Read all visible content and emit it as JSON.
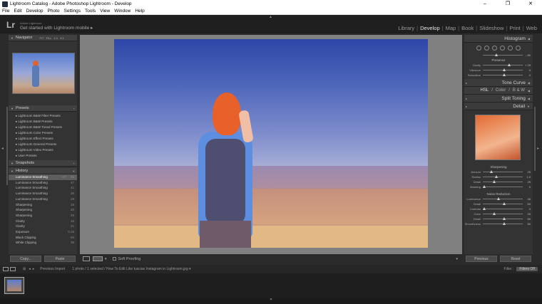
{
  "window": {
    "title": "Lightroom Catalog - Adobe Photoshop Lightroom - Develop",
    "controls": [
      "–",
      "❐",
      "✕"
    ]
  },
  "menu": [
    "File",
    "Edit",
    "Develop",
    "Photo",
    "Settings",
    "Tools",
    "View",
    "Window",
    "Help"
  ],
  "identity": {
    "logo": "Lr",
    "line1": "Adobe Lightroom",
    "line2": "Get started with Lightroom mobile ▸"
  },
  "modules": [
    "Library",
    "Develop",
    "Map",
    "Book",
    "Slideshow",
    "Print",
    "Web"
  ],
  "active_module": "Develop",
  "left_panel": {
    "navigator": {
      "label": "Navigator",
      "zoom": [
        "FIT",
        "FILL",
        "1:1",
        "3:1"
      ]
    },
    "presets": {
      "label": "Presets",
      "items": [
        "Lightroom B&W Filter Presets",
        "Lightroom B&W Presets",
        "Lightroom B&W Toned Presets",
        "Lightroom Color Presets",
        "Lightroom Effect Presets",
        "Lightroom General Presets",
        "Lightroom Video Presets",
        "User Presets"
      ]
    },
    "snapshots": {
      "label": "Snapshots"
    },
    "history": {
      "label": "History",
      "items": [
        {
          "name": "Luminance Smoothing",
          "from": "+47",
          "to": "36"
        },
        {
          "name": "Luminance Smoothing",
          "from": "",
          "to": "47"
        },
        {
          "name": "Luminance Smoothing",
          "from": "",
          "to": "41"
        },
        {
          "name": "Luminance Smoothing",
          "from": "",
          "to": "36"
        },
        {
          "name": "Luminance Smoothing",
          "from": "",
          "to": "29"
        },
        {
          "name": "Sharpening",
          "from": "",
          "to": "15"
        },
        {
          "name": "Sharpening",
          "from": "",
          "to": "20"
        },
        {
          "name": "Sharpening",
          "from": "",
          "to": "25"
        },
        {
          "name": "Clarity",
          "from": "",
          "to": "16"
        },
        {
          "name": "Clarity",
          "from": "",
          "to": "21"
        },
        {
          "name": "Exposure",
          "from": "",
          "to": "0.15"
        },
        {
          "name": "Black Clipping",
          "from": "",
          "to": "-34"
        },
        {
          "name": "White Clipping",
          "from": "",
          "to": "39"
        }
      ]
    },
    "copy": "Copy...",
    "paste": "Paste"
  },
  "toolbar": {
    "soft_proofing": "Soft Proofing",
    "dropdown": "▾"
  },
  "right_panel": {
    "histogram": "Histogram",
    "presence": {
      "label": "Presence",
      "rows": [
        {
          "label": "Clarity",
          "value": "+ 25",
          "pos": 0.62
        },
        {
          "label": "Vibrance",
          "value": "0",
          "pos": 0.5
        },
        {
          "label": "Saturation",
          "value": "0",
          "pos": 0.5
        }
      ],
      "top_value": "– 80"
    },
    "tone_curve": "Tone Curve",
    "hsl": {
      "hsl": "HSL",
      "color": "Color",
      "bw": "B & W"
    },
    "split_toning": "Split Toning",
    "detail": "Detail",
    "sharpening": {
      "label": "Sharpening",
      "rows": [
        {
          "label": "Amount",
          "value": "25",
          "pos": 0.17
        },
        {
          "label": "Radius",
          "value": "1.0",
          "pos": 0.3
        },
        {
          "label": "Detail",
          "value": "25",
          "pos": 0.25
        },
        {
          "label": "Masking",
          "value": "0",
          "pos": 0.0
        }
      ]
    },
    "noise_reduction": {
      "label": "Noise Reduction",
      "rows": [
        {
          "label": "Luminance",
          "value": "36",
          "pos": 0.36
        },
        {
          "label": "Detail",
          "value": "50",
          "pos": 0.5
        },
        {
          "label": "Contrast",
          "value": "0",
          "pos": 0.0
        },
        {
          "label": "Color",
          "value": "25",
          "pos": 0.25
        },
        {
          "label": "Detail",
          "value": "50",
          "pos": 0.5
        },
        {
          "label": "Smoothness",
          "value": "50",
          "pos": 0.5
        }
      ]
    },
    "previous": "Previous",
    "reset": "Reset"
  },
  "filmstrip": {
    "prev_import": "Previous Import",
    "info": "1 photo / 1 selected / How To Edit Like tuscias Instagram in Lightroom.jpg ▾",
    "filter_label": "Filter :",
    "filter_value": "Filters Off"
  }
}
